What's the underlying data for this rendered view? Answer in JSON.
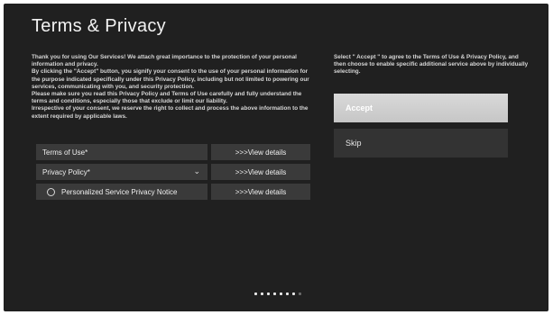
{
  "page": {
    "title": "Terms & Privacy",
    "intro": "Thank you for using Our Services! We attach great importance to the protection of your personal information and privacy.\nBy clicking the \"Accept\" button, you signify your consent to the use of your personal information for the purpose indicated specifically under this Privacy Policy, including but not limited to powering our services, communicating with you, and security protection.\nPlease make sure you read this Privacy Policy and Terms of Use carefully and fully understand the terms and conditions, especially those that exclude or limit our liability.\nIrrespective of your consent, we reserve the right to collect and process the above information to the extent required by applicable laws.",
    "side_instruction": "Select \" Accept \" to agree to the Terms of Use & Privacy Policy, and then choose to enable specific additional service above by individually selecting."
  },
  "rows": [
    {
      "label": "Terms of Use*",
      "action": ">>>View details"
    },
    {
      "label": "Privacy Policy*",
      "action": ">>>View details"
    },
    {
      "label": "Personalized Service Privacy Notice",
      "action": ">>>View details"
    }
  ],
  "buttons": {
    "accept": "Accept",
    "skip": "Skip"
  },
  "pager": {
    "total": 8,
    "active": 7
  },
  "icons": {
    "chevron": "chevron-down-icon",
    "radio": "radio-unchecked-icon"
  },
  "colors": {
    "background": "#202020",
    "row": "#3a3a3a",
    "accept": "#d2d2d2",
    "skip": "#333333"
  }
}
